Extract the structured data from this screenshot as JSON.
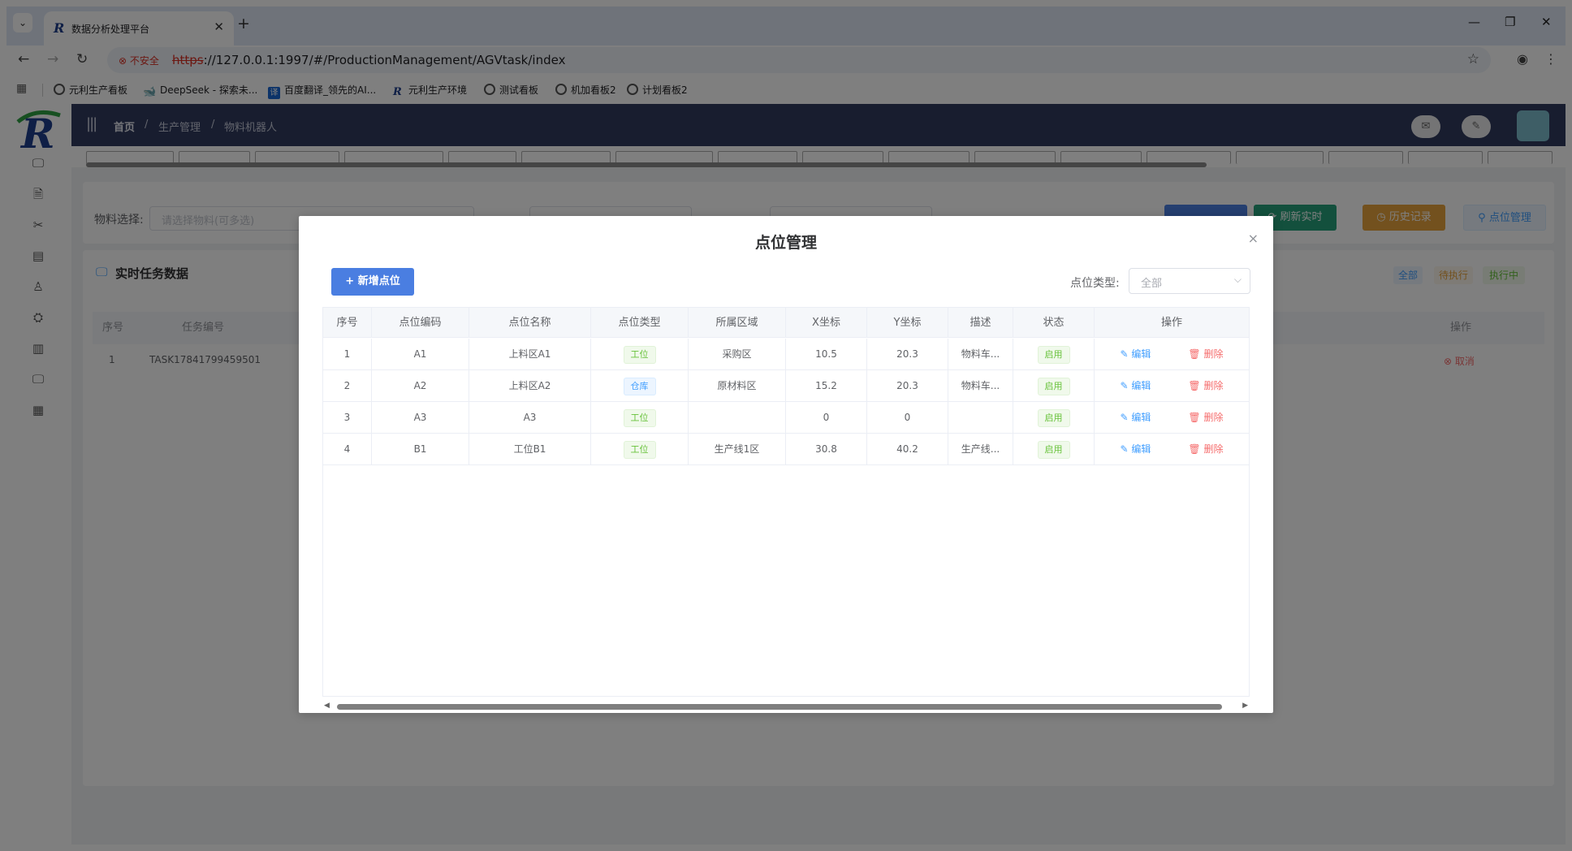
{
  "browser": {
    "tab_title": "数据分析处理平台",
    "tab_close": "✕",
    "new_tab": "+",
    "insecure_label": "不安全",
    "url_scheme": "https",
    "url_rest": "://127.0.0.1:1997/#/ProductionManagement/AGVtask/index",
    "bookmarks": [
      "元利生产看板",
      "DeepSeek - 探索未...",
      "百度翻译_领先的AI...",
      "元利生产环境",
      "测试看板",
      "机加看板2",
      "计划看板2"
    ]
  },
  "app": {
    "breadcrumb": [
      "首页",
      "生产管理",
      "物料机器人"
    ],
    "breadcrumb_sep": "/",
    "filters": {
      "material_label": "物料选择:",
      "material_placeholder": "请选择物料(可多选)"
    },
    "buttons": {
      "refresh": "⟳ 刷新实时",
      "history": "◷ 历史记录",
      "points": "⚲ 点位管理"
    },
    "section_title": "实时任务数据",
    "status_chips": [
      "全部",
      "待执行",
      "执行中"
    ],
    "bg_table": {
      "headers": [
        "序号",
        "任务编号",
        "操作"
      ],
      "row": {
        "index": "1",
        "task_no": "TASK17841799459501",
        "action": "⊗ 取消"
      }
    }
  },
  "dialog": {
    "title": "点位管理",
    "close_icon": "×",
    "add_button": "+ 新增点位",
    "filter_label": "点位类型:",
    "filter_value": "全部",
    "filter_arrow": "⌵",
    "columns": [
      "序号",
      "点位编码",
      "点位名称",
      "点位类型",
      "所属区域",
      "X坐标",
      "Y坐标",
      "描述",
      "状态",
      "操作"
    ],
    "edit_label": "✎ 编辑",
    "delete_label": "🗑 删除",
    "rows": [
      {
        "index": "1",
        "code": "A1",
        "name": "上料区A1",
        "type": "工位",
        "area": "采购区",
        "x": "10.5",
        "y": "20.3",
        "desc": "物料车...",
        "status": "启用"
      },
      {
        "index": "2",
        "code": "A2",
        "name": "上料区A2",
        "type": "仓库",
        "area": "原材料区",
        "x": "15.2",
        "y": "20.3",
        "desc": "物料车...",
        "status": "启用"
      },
      {
        "index": "3",
        "code": "A3",
        "name": "A3",
        "type": "工位",
        "area": "",
        "x": "0",
        "y": "0",
        "desc": "",
        "status": "启用"
      },
      {
        "index": "4",
        "code": "B1",
        "name": "工位B1",
        "type": "工位",
        "area": "生产线1区",
        "x": "30.8",
        "y": "40.2",
        "desc": "生产线...",
        "status": "启用"
      }
    ]
  },
  "colors": {
    "primary": "#4a7ee1",
    "header": "#303a5f",
    "success": "#67c23a",
    "danger": "#f56c6c",
    "warning": "#e6a23c"
  }
}
